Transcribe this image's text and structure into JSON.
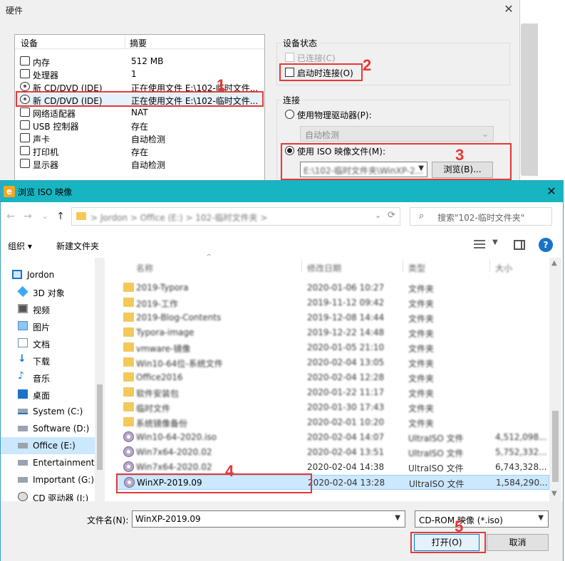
{
  "hardware_dialog": {
    "title": "硬件",
    "close_glyph": "✕",
    "device_header": {
      "device": "设备",
      "summary": "摘要"
    },
    "devices": [
      {
        "name": "内存",
        "summary": "512 MB",
        "icon": "memory-icon"
      },
      {
        "name": "处理器",
        "summary": "1",
        "icon": "cpu-icon"
      },
      {
        "name": "新 CD/DVD (IDE)",
        "summary": "正在使用文件 E:\\102-临时文件...",
        "icon": "cd-icon"
      },
      {
        "name": "新 CD/DVD (IDE)",
        "summary": "正在使用文件 E:\\102-临时文件...",
        "icon": "cd-icon"
      },
      {
        "name": "网络适配器",
        "summary": "NAT",
        "icon": "network-icon"
      },
      {
        "name": "USB 控制器",
        "summary": "存在",
        "icon": "usb-icon"
      },
      {
        "name": "声卡",
        "summary": "自动检测",
        "icon": "sound-icon"
      },
      {
        "name": "打印机",
        "summary": "存在",
        "icon": "printer-icon"
      },
      {
        "name": "显示器",
        "summary": "自动检测",
        "icon": "monitor-icon"
      }
    ],
    "device_status": {
      "title": "设备状态",
      "connected_label": "已连接(C)",
      "connect_at_power_on_label": "启动时连接(O)"
    },
    "connection": {
      "title": "连接",
      "physical_label": "使用物理驱动器(P):",
      "physical_value": "自动检测",
      "iso_label": "使用 ISO 映像文件(M):",
      "iso_value": "E:\\102-临时文件夹\\WinXP-2...",
      "browse_label": "浏览(B)..."
    }
  },
  "annotations": [
    "1",
    "2",
    "3",
    "4",
    "5"
  ],
  "file_dialog": {
    "title": "浏览 ISO 映像",
    "logo_glyph": "e",
    "close_glyph": "✕",
    "nav": {
      "back": "←",
      "forward": "→",
      "recent": "⌄",
      "up": "↑"
    },
    "address_path": "> Jordon > Office (E:) > 102-临时文件夹 >",
    "search_placeholder": "搜索\"102-临时文件夹\"",
    "toolbar": {
      "organize": "组织 ▾",
      "new_folder": "新建文件夹",
      "help": "?"
    },
    "nav_pane": [
      {
        "label": "Jordon",
        "icon": "computer-icon"
      },
      {
        "label": "3D 对象",
        "icon": "3d-objects-icon"
      },
      {
        "label": "视频",
        "icon": "video-icon"
      },
      {
        "label": "图片",
        "icon": "pictures-icon"
      },
      {
        "label": "文档",
        "icon": "documents-icon"
      },
      {
        "label": "下载",
        "icon": "download-icon"
      },
      {
        "label": "音乐",
        "icon": "music-icon"
      },
      {
        "label": "桌面",
        "icon": "desktop-icon"
      },
      {
        "label": "System (C:)",
        "icon": "drive-icon"
      },
      {
        "label": "Software (D:)",
        "icon": "drive-icon"
      },
      {
        "label": "Office (E:)",
        "icon": "drive-icon"
      },
      {
        "label": "Entertainment (",
        "icon": "drive-icon"
      },
      {
        "label": "Important (G:)",
        "icon": "drive-icon"
      },
      {
        "label": "CD 驱动器 (I:)",
        "icon": "cd-drive-icon"
      }
    ],
    "columns": {
      "name": "名称",
      "date": "修改日期",
      "type": "类型",
      "size": "大小"
    },
    "files": [
      {
        "name": "2019-Typora",
        "date": "2020-01-06 10:27",
        "type": "文件夹",
        "size": "",
        "kind": "folder"
      },
      {
        "name": "2019-工作",
        "date": "2019-11-12 09:42",
        "type": "文件夹",
        "size": "",
        "kind": "folder"
      },
      {
        "name": "2019-Blog-Contents",
        "date": "2019-12-08 14:44",
        "type": "文件夹",
        "size": "",
        "kind": "folder"
      },
      {
        "name": "Typora-image",
        "date": "2019-12-22 14:48",
        "type": "文件夹",
        "size": "",
        "kind": "folder"
      },
      {
        "name": "vmware-镜像",
        "date": "2020-01-05 21:10",
        "type": "文件夹",
        "size": "",
        "kind": "folder"
      },
      {
        "name": "Win10-64位-系统文件",
        "date": "2020-02-04 13:05",
        "type": "文件夹",
        "size": "",
        "kind": "folder"
      },
      {
        "name": "Office2016",
        "date": "2020-02-04 12:28",
        "type": "文件夹",
        "size": "",
        "kind": "folder"
      },
      {
        "name": "软件安装包",
        "date": "2020-01-22 11:17",
        "type": "文件夹",
        "size": "",
        "kind": "folder"
      },
      {
        "name": "临时文件",
        "date": "2020-01-30 17:43",
        "type": "文件夹",
        "size": "",
        "kind": "folder"
      },
      {
        "name": "系统镜像备份",
        "date": "2020-02-01 10:20",
        "type": "文件夹",
        "size": "",
        "kind": "folder"
      },
      {
        "name": "Win10-64-2020.iso",
        "date": "2020-02-04 14:07",
        "type": "UltraISO 文件",
        "size": "4,512,098...",
        "kind": "iso"
      },
      {
        "name": "Win7x64-2020.02",
        "date": "2020-02-04 13:51",
        "type": "UltraISO 文件",
        "size": "5,752,332...",
        "kind": "iso"
      },
      {
        "name": "Win7x64-2020.02",
        "date": "2020-02-04 14:38",
        "type": "UltraISO 文件",
        "size": "6,743,328...",
        "kind": "iso"
      },
      {
        "name": "WinXP-2019.09",
        "date": "2020-02-04 13:28",
        "type": "UltraISO 文件",
        "size": "1,584,290...",
        "kind": "iso"
      }
    ],
    "filename_label": "文件名(N):",
    "filename_value": "WinXP-2019.09",
    "filetype_value": "CD-ROM 映像 (*.iso)",
    "open_label": "打开(O)",
    "cancel_label": "取消"
  },
  "colors": {
    "titlebar": "#17b4c1",
    "annotation": "#e53935",
    "selection": "#cce8ff"
  }
}
